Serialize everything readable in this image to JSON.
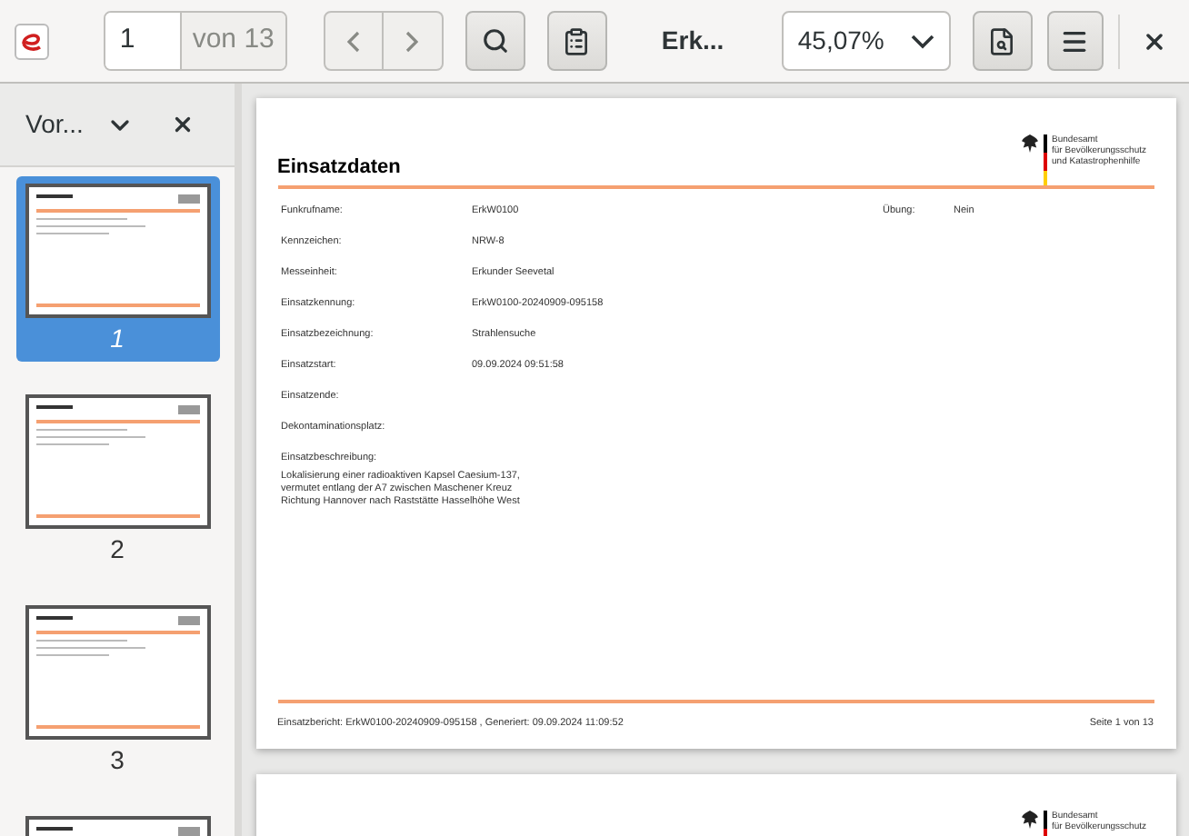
{
  "toolbar": {
    "page_field": {
      "value": "1",
      "total": "von 13"
    },
    "title": "Erk...",
    "zoom": "45,07%"
  },
  "sidebar": {
    "title": "Vor...",
    "thumbnails": [
      {
        "label": "1",
        "selected": true
      },
      {
        "label": "2",
        "selected": false
      },
      {
        "label": "3",
        "selected": false
      },
      {
        "selected": false
      }
    ]
  },
  "pages": [
    {
      "title": "Einsatzdaten",
      "logo": [
        "Bundesamt",
        "für Bevölkerungsschutz",
        "und Katastrophenhilfe"
      ],
      "fields": [
        {
          "label": "Funkrufname:",
          "value": "ErkW0100",
          "extra_label": "Übung:",
          "extra_value": "Nein"
        },
        {
          "label": "Kennzeichen:",
          "value": "NRW-8"
        },
        {
          "label": "Messeinheit:",
          "value": "Erkunder Seevetal"
        },
        {
          "label": "Einsatzkennung:",
          "value": "ErkW0100-20240909-095158"
        },
        {
          "label": "Einsatzbezeichnung:",
          "value": "Strahlensuche"
        },
        {
          "label": "Einsatzstart:",
          "value": "09.09.2024 09:51:58"
        },
        {
          "label": "Einsatzende:"
        },
        {
          "label": "Dekontaminationsplatz:"
        },
        {
          "label": "Einsatzbeschreibung:"
        }
      ],
      "description": [
        "Lokalisierung einer radioaktiven Kapsel Caesium-137,",
        "vermutet entlang der A7 zwischen Maschener Kreuz",
        "Richtung Hannover nach Raststätte Hasselhöhe West"
      ],
      "footer": "Einsatzbericht: ErkW0100-20240909-095158 , Generiert: 09.09.2024 11:09:52",
      "page_number": "Seite 1 von 13"
    },
    {
      "logo": [
        "Bundesamt",
        "für Bevölkerungsschutz"
      ]
    }
  ]
}
